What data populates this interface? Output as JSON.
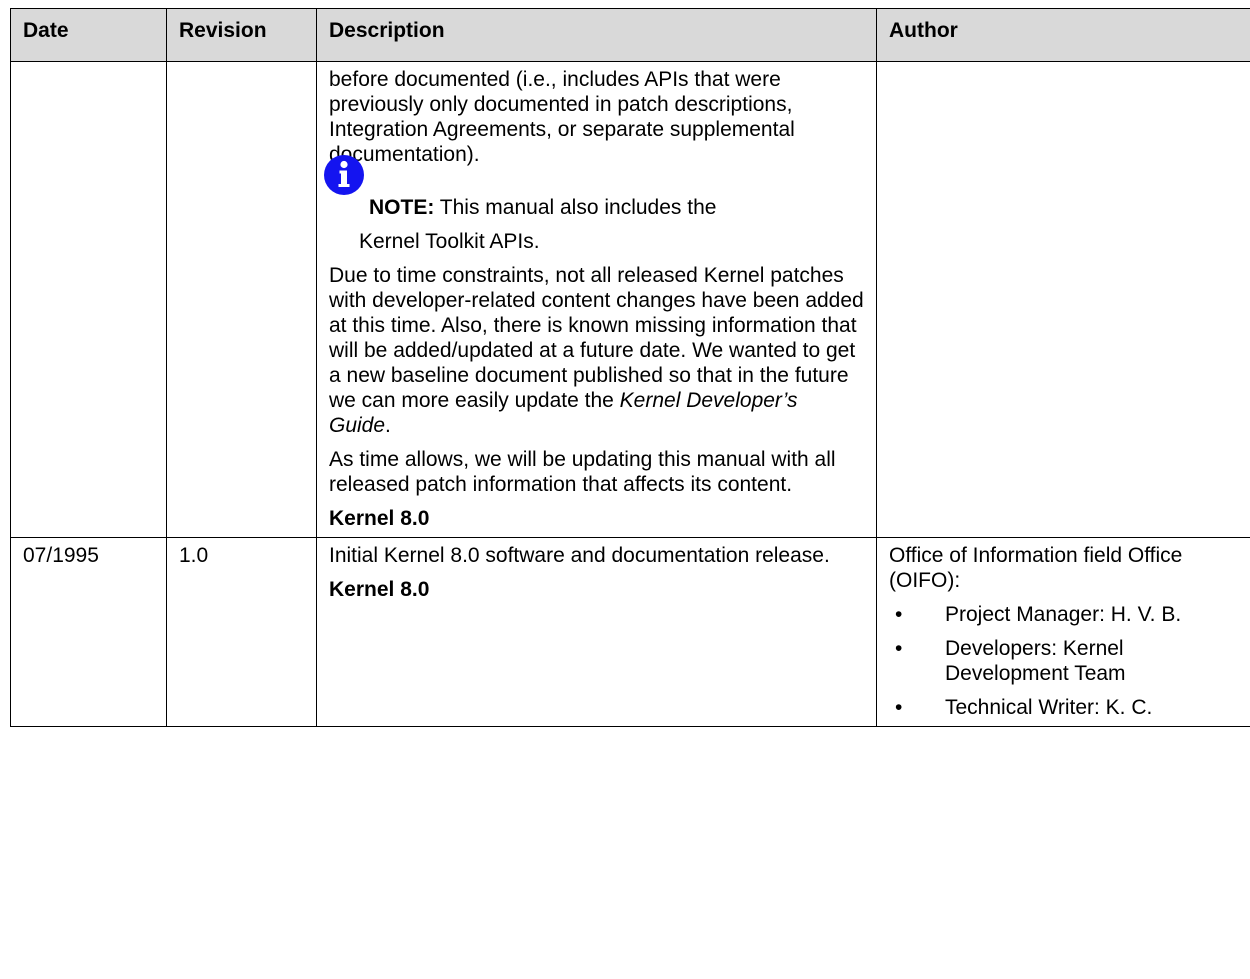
{
  "table": {
    "headers": {
      "date": "Date",
      "revision": "Revision",
      "description": "Description",
      "author": "Author"
    },
    "row1": {
      "date": "",
      "revision": "",
      "para1": "before documented (i.e., includes APIs that were previously only documented in patch descriptions, Integration Agreements, or separate supplemental documentation).",
      "note_label": "NOTE:",
      "note_text": " This manual also includes the",
      "note_text2": "Kernel Toolkit APIs.",
      "para2_a": "Due to time constraints, not all released Kernel patches with developer-related content changes have been added at this time. Also, there is known missing information that will be added/updated at a future date. We wanted to get a new baseline document published so that in the future we can more easily update the ",
      "para2_title": "Kernel Developer’s Guide",
      "para2_b": ".",
      "para3": "As time allows, we will be updating this manual with all released patch information that affects its content.",
      "footer_label": "Kernel 8.0",
      "author": ""
    },
    "row2": {
      "date": "07/1995",
      "revision": "1.0",
      "desc": "Initial Kernel 8.0 software and documentation release.",
      "footer_label": "Kernel 8.0",
      "author_intro": "Office of Information field Office (OIFO):",
      "people": [
        "Project Manager:  H. V. B.",
        "Developers:  Kernel Development Team",
        "Technical Writer:  K. C."
      ]
    }
  },
  "colors": {
    "header_bg": "#d9d9d9",
    "icon_blue": "#1414f0"
  },
  "icons": {
    "note": "info-icon"
  }
}
